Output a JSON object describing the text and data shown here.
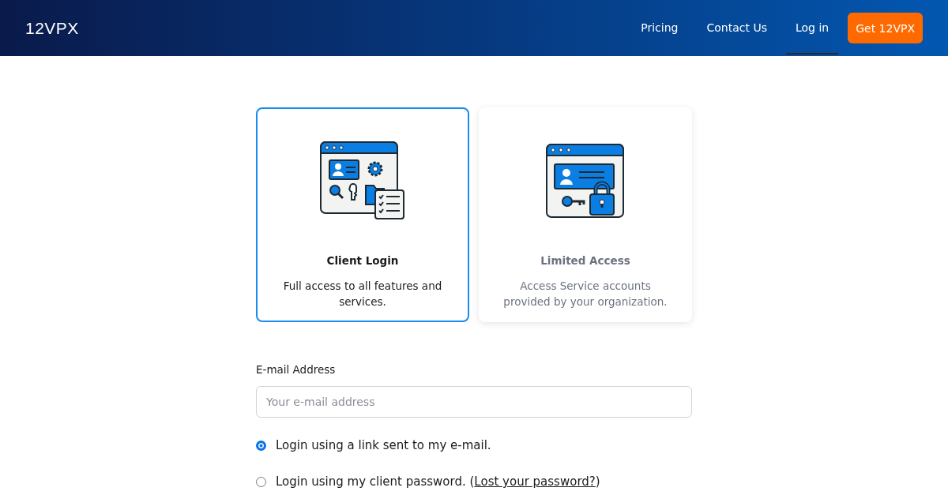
{
  "header": {
    "logo": "12VPX",
    "nav": [
      {
        "label": "Pricing",
        "selected": false,
        "kind": "link"
      },
      {
        "label": "Contact Us",
        "selected": false,
        "kind": "link"
      },
      {
        "label": "Log in",
        "selected": true,
        "kind": "link"
      },
      {
        "label": "Get 12VPX",
        "selected": false,
        "kind": "cta"
      }
    ]
  },
  "account_types": [
    {
      "title": "Client Login",
      "description": "Full access to all features and services.",
      "selected": true,
      "kind": "client"
    },
    {
      "title": "Limited Access",
      "description": "Access Service accounts provided by your organization.",
      "selected": false,
      "kind": "limited"
    }
  ],
  "email": {
    "label": "E-mail Address",
    "placeholder": "Your e-mail address"
  },
  "login_options": [
    {
      "text": "Login using a link sent to my e-mail.",
      "selected": true
    },
    {
      "text": "Login using my client password. (",
      "link": "Lost your password?",
      "after": ")",
      "selected": false
    }
  ]
}
